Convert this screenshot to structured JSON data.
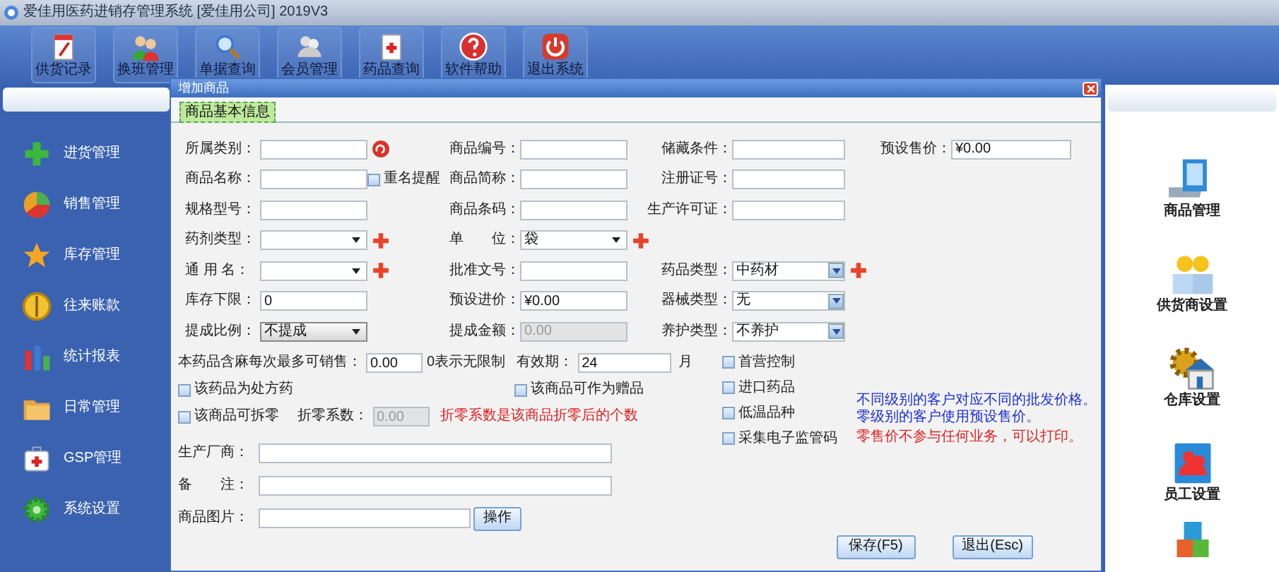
{
  "window": {
    "title": "爱佳用医药进销存管理系统 [爱佳用公司] 2019V3"
  },
  "toolbar": [
    {
      "label": "供货记录"
    },
    {
      "label": "换班管理"
    },
    {
      "label": "单据查询"
    },
    {
      "label": "会员管理"
    },
    {
      "label": "药品查询"
    },
    {
      "label": "软件帮助"
    },
    {
      "label": "退出系统"
    }
  ],
  "sidebar": {
    "items": [
      {
        "label": "进货管理"
      },
      {
        "label": "销售管理"
      },
      {
        "label": "库存管理"
      },
      {
        "label": "往来账款"
      },
      {
        "label": "统计报表"
      },
      {
        "label": "日常管理"
      },
      {
        "label": "GSP管理"
      },
      {
        "label": "系统设置"
      }
    ]
  },
  "right_panel": {
    "items": [
      {
        "label": "商品管理"
      },
      {
        "label": "供货商设置"
      },
      {
        "label": "仓库设置"
      },
      {
        "label": "员工设置"
      }
    ]
  },
  "dialog": {
    "title": "增加商品",
    "tabs": [
      {
        "label": "商品基本信息",
        "selected": true
      }
    ],
    "rows": [
      {
        "col_1": {
          "label": "所属类别：",
          "kind": "text",
          "lookup_button": true
        },
        "col_2": {
          "label": "商品编号：",
          "kind": "text"
        },
        "col_3": {
          "label": "储藏条件：",
          "kind": "text"
        },
        "col_4": {
          "label": "预设售价：",
          "kind": "text",
          "value": "¥0.00"
        }
      },
      {
        "col_1": {
          "label": "商品名称：",
          "kind": "text",
          "check": {
            "label": "重名提醒",
            "checked": false
          }
        },
        "col_2": {
          "label": "商品简称：",
          "kind": "text"
        },
        "col_3": {
          "label": "注册证号：",
          "kind": "text"
        }
      },
      {
        "col_1": {
          "label": "规格型号：",
          "kind": "text"
        },
        "col_2": {
          "label": "商品条码：",
          "kind": "text"
        },
        "col_3": {
          "label": "生产许可证：",
          "kind": "text"
        }
      },
      {
        "col_1": {
          "label": "药剂类型：",
          "kind": "select",
          "add_button": true
        },
        "col_2": {
          "label": "单　　位：",
          "kind": "select",
          "value": "袋",
          "add_button": true
        }
      },
      {
        "col_1": {
          "label": "通 用 名：",
          "kind": "select",
          "add_button": true
        },
        "col_2": {
          "label": "批准文号：",
          "kind": "text"
        },
        "col_3": {
          "label": "药品类型：",
          "kind": "combo",
          "value": "中药材",
          "add_button": true
        }
      },
      {
        "col_1": {
          "label": "库存下限：",
          "kind": "text",
          "value": "0"
        },
        "col_2": {
          "label": "预设进价：",
          "kind": "text",
          "value": "¥0.00"
        },
        "col_3": {
          "label": "器械类型：",
          "kind": "combo",
          "value": "无"
        }
      },
      {
        "col_1": {
          "label": "提成比例：",
          "kind": "picker",
          "value": "不提成"
        },
        "col_2": {
          "label": "提成金额：",
          "kind": "readonly",
          "value": "0.00"
        },
        "col_3": {
          "label": "养护类型：",
          "kind": "combo",
          "value": "不养护"
        }
      }
    ],
    "limit_row": {
      "label": "本药品含麻每次最多可销售：",
      "value": "0.00",
      "hint": "0表示无限制",
      "expiry_label": "有效期：",
      "expiry_value": "24",
      "expiry_unit": "月"
    },
    "option_checks": [
      {
        "label": "该药品为处方药",
        "checked": false
      },
      {
        "label": "该商品可作为赠品",
        "checked": false
      }
    ],
    "split_row": {
      "check": {
        "label": "该商品可拆零",
        "checked": false
      },
      "factor_label": "折零系数：",
      "factor_value": "0.00",
      "note": "折零系数是该商品折零后的个数"
    },
    "wide_fields": [
      {
        "label": "生产厂商："
      },
      {
        "label": "备　　注："
      },
      {
        "label": "商品图片：",
        "button": "操作"
      }
    ],
    "flags": [
      {
        "label": "首营控制",
        "checked": false
      },
      {
        "label": "进口药品",
        "checked": false
      },
      {
        "label": "低温品种",
        "checked": false
      },
      {
        "label": "采集电子监管码",
        "checked": false
      }
    ],
    "notes": [
      {
        "text": "不同级别的客户对应不同的批发价格。",
        "kind": "info"
      },
      {
        "text": "零级别的客户使用预设售价。",
        "kind": "info"
      },
      {
        "text": "零售价不参与任何业务，可以打印。",
        "kind": "warning"
      }
    ],
    "buttons": [
      {
        "label": "保存(F5)"
      },
      {
        "label": "退出(Esc)"
      }
    ]
  }
}
